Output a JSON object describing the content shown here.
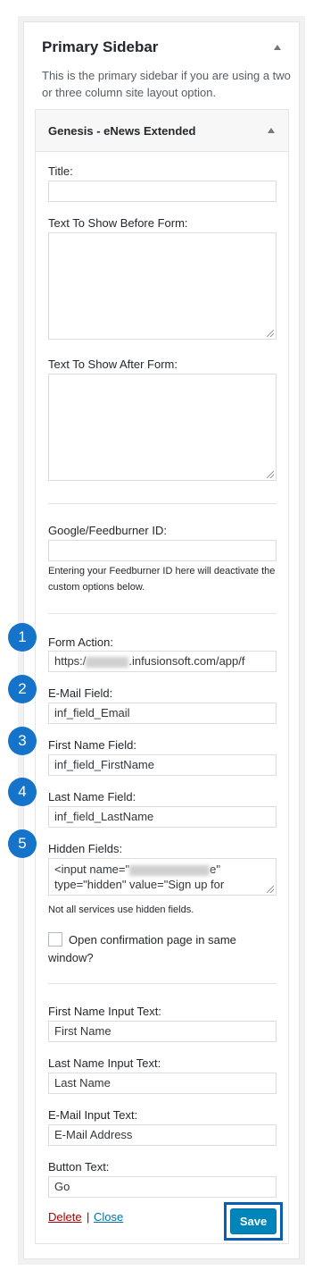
{
  "sidebar": {
    "title": "Primary Sidebar",
    "description": "This is the primary sidebar if you are using a two or three column site layout option."
  },
  "widget": {
    "title": "Genesis - eNews Extended",
    "fields": {
      "title_label": "Title:",
      "title_value": "",
      "before_label": "Text To Show Before Form:",
      "after_label": "Text To Show After Form:",
      "feedburner_label": "Google/Feedburner ID:",
      "feedburner_value": "",
      "feedburner_help": "Entering your Feedburner ID here will deactivate the custom options below.",
      "form_action_label": "Form Action:",
      "form_action_prefix": "https:/",
      "form_action_suffix": ".infusionsoft.com/app/f",
      "email_field_label": "E-Mail Field:",
      "email_field_value": "inf_field_Email",
      "first_name_field_label": "First Name Field:",
      "first_name_field_value": "inf_field_FirstName",
      "last_name_field_label": "Last Name Field:",
      "last_name_field_value": "inf_field_LastName",
      "hidden_fields_label": "Hidden Fields:",
      "hidden_line1_prefix": "<input name=\"",
      "hidden_line1_suffix": "e\"",
      "hidden_line2": "type=\"hidden\" value=\"Sign up for",
      "hidden_help": "Not all services use hidden fields.",
      "confirm_label": "Open confirmation page in same window?",
      "first_name_input_label": "First Name Input Text:",
      "first_name_input_value": "First Name",
      "last_name_input_label": "Last Name Input Text:",
      "last_name_input_value": "Last Name",
      "email_input_label": "E-Mail Input Text:",
      "email_input_value": "E-Mail Address",
      "button_text_label": "Button Text:",
      "button_text_value": "Go"
    },
    "actions": {
      "delete": "Delete",
      "separator": "|",
      "close": "Close",
      "save": "Save"
    }
  },
  "badges": [
    "1",
    "2",
    "3",
    "4",
    "5"
  ],
  "colors": {
    "badge": "#1573c9",
    "save_button": "#0085ba",
    "save_outline": "#0a5db3",
    "delete_link": "#a00",
    "close_link": "#0073aa"
  },
  "icons": {
    "sidebar_toggle": "caret-up-icon",
    "widget_toggle": "caret-up-icon"
  }
}
